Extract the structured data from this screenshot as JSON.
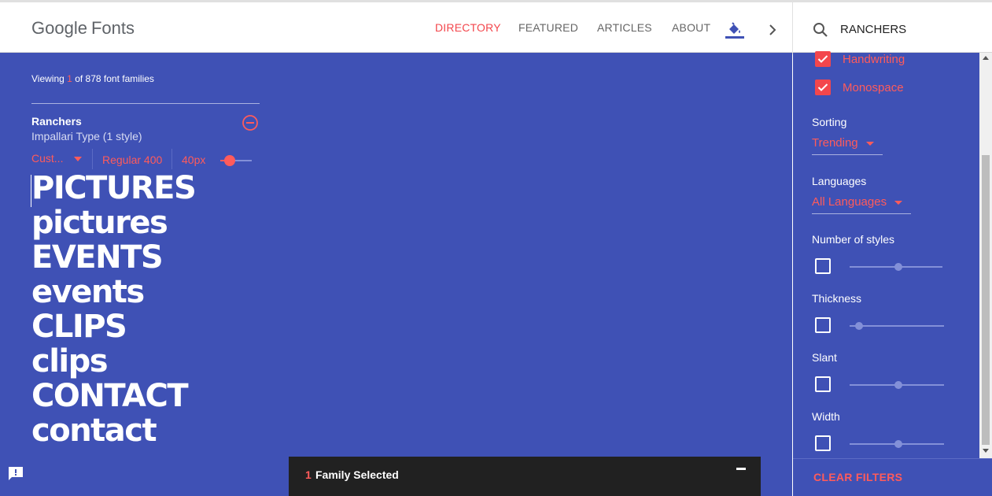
{
  "header": {
    "logo_google": "Google",
    "logo_fonts": "Fonts",
    "nav": {
      "directory": "DIRECTORY",
      "featured": "FEATURED",
      "articles": "ARTICLES",
      "about": "ABOUT"
    },
    "search_value": "RANCHERS"
  },
  "main": {
    "viewing_prefix": "Viewing",
    "viewing_count": "1",
    "viewing_suffix": "of 878 font families",
    "font": {
      "name": "Ranchers",
      "foundry": "Impallari Type (1 style)",
      "sample_type": "Cust...",
      "weight": "Regular 400",
      "size": "40px",
      "size_slider_fraction": 0.3
    },
    "sample_lines": [
      "PICTURES",
      "pictures",
      "EVENTS",
      "events",
      "CLIPS",
      "clips",
      "CONTACT",
      "contact"
    ]
  },
  "tray": {
    "count": "1",
    "label": "Family Selected"
  },
  "sidebar": {
    "categories": [
      {
        "label": "Handwriting",
        "checked": true
      },
      {
        "label": "Monospace",
        "checked": true
      }
    ],
    "sorting": {
      "title": "Sorting",
      "value": "Trending"
    },
    "languages": {
      "title": "Languages",
      "value": "All Languages"
    },
    "filters": [
      {
        "title": "Number of styles",
        "enabled": false,
        "fraction": 0.52
      },
      {
        "title": "Thickness",
        "enabled": false,
        "fraction": 0.1
      },
      {
        "title": "Slant",
        "enabled": false,
        "fraction": 0.52
      },
      {
        "title": "Width",
        "enabled": false,
        "fraction": 0.52
      }
    ],
    "clear_filters": "CLEAR FILTERS"
  },
  "colors": {
    "accent": "#f3464c",
    "canvas": "#3f51b5",
    "tray": "#212121"
  }
}
